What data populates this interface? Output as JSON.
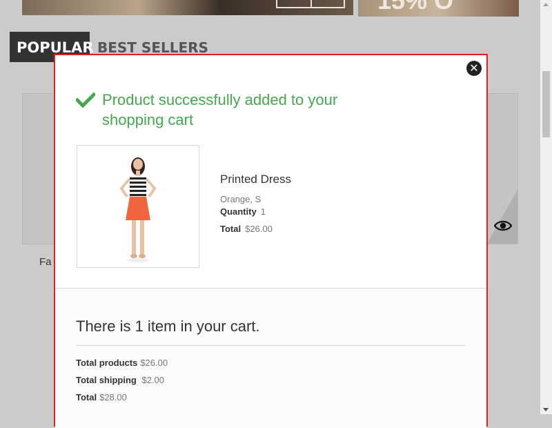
{
  "background": {
    "banner_text": "15% O",
    "tabs": [
      {
        "label": "POPULAR",
        "active": true
      },
      {
        "label": "BEST SELLERS",
        "active": false
      }
    ],
    "product_name_partial": "Fa"
  },
  "modal": {
    "close_icon": "close-icon",
    "success_icon": "check-icon",
    "success_message": "Product successfully added to your shopping cart",
    "product": {
      "name": "Printed Dress",
      "attributes": "Orange, S",
      "quantity_label": "Quantity",
      "quantity": "1",
      "total_label": "Total",
      "total": "$26.00"
    },
    "cart": {
      "count_message": "There is 1 item in your cart.",
      "total_products_label": "Total products",
      "total_products": "$26.00",
      "total_shipping_label": "Total shipping",
      "total_shipping": "$2.00",
      "total_label": "Total",
      "total": "$28.00"
    },
    "accent_color": "#46a74e",
    "border_color": "#e02020"
  }
}
